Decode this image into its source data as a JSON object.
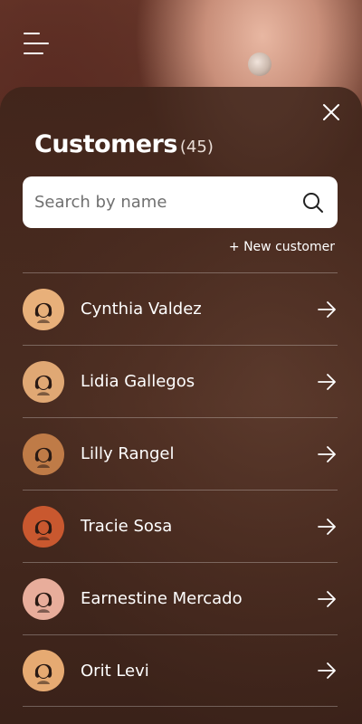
{
  "header": {
    "menu_icon": "hamburger-menu-icon"
  },
  "panel": {
    "close_icon": "close-icon",
    "title": "Customers",
    "count": "(45)",
    "search": {
      "placeholder": "Search by name",
      "value": "",
      "icon": "search-icon"
    },
    "new_customer_label": "+ New customer"
  },
  "customers": [
    {
      "name": "Cynthia Valdez",
      "avatar_bg": "#e8b07a",
      "avatar_icon": "woman-avatar-icon"
    },
    {
      "name": "Lidia Gallegos",
      "avatar_bg": "#e0a874",
      "avatar_icon": "woman-avatar-icon"
    },
    {
      "name": "Lilly Rangel",
      "avatar_bg": "#bf7b47",
      "avatar_icon": "woman-avatar-icon"
    },
    {
      "name": "Tracie Sosa",
      "avatar_bg": "#c9582f",
      "avatar_icon": "woman-avatar-icon"
    },
    {
      "name": "Earnestine Mercado",
      "avatar_bg": "#e8ad9b",
      "avatar_icon": "woman-avatar-icon"
    },
    {
      "name": "Orit Levi",
      "avatar_bg": "#e6aa72",
      "avatar_icon": "woman-avatar-icon"
    }
  ],
  "colors": {
    "panel_bg": "#4a2e22",
    "text": "#ffffff",
    "divider": "rgba(255,255,255,0.28)"
  }
}
